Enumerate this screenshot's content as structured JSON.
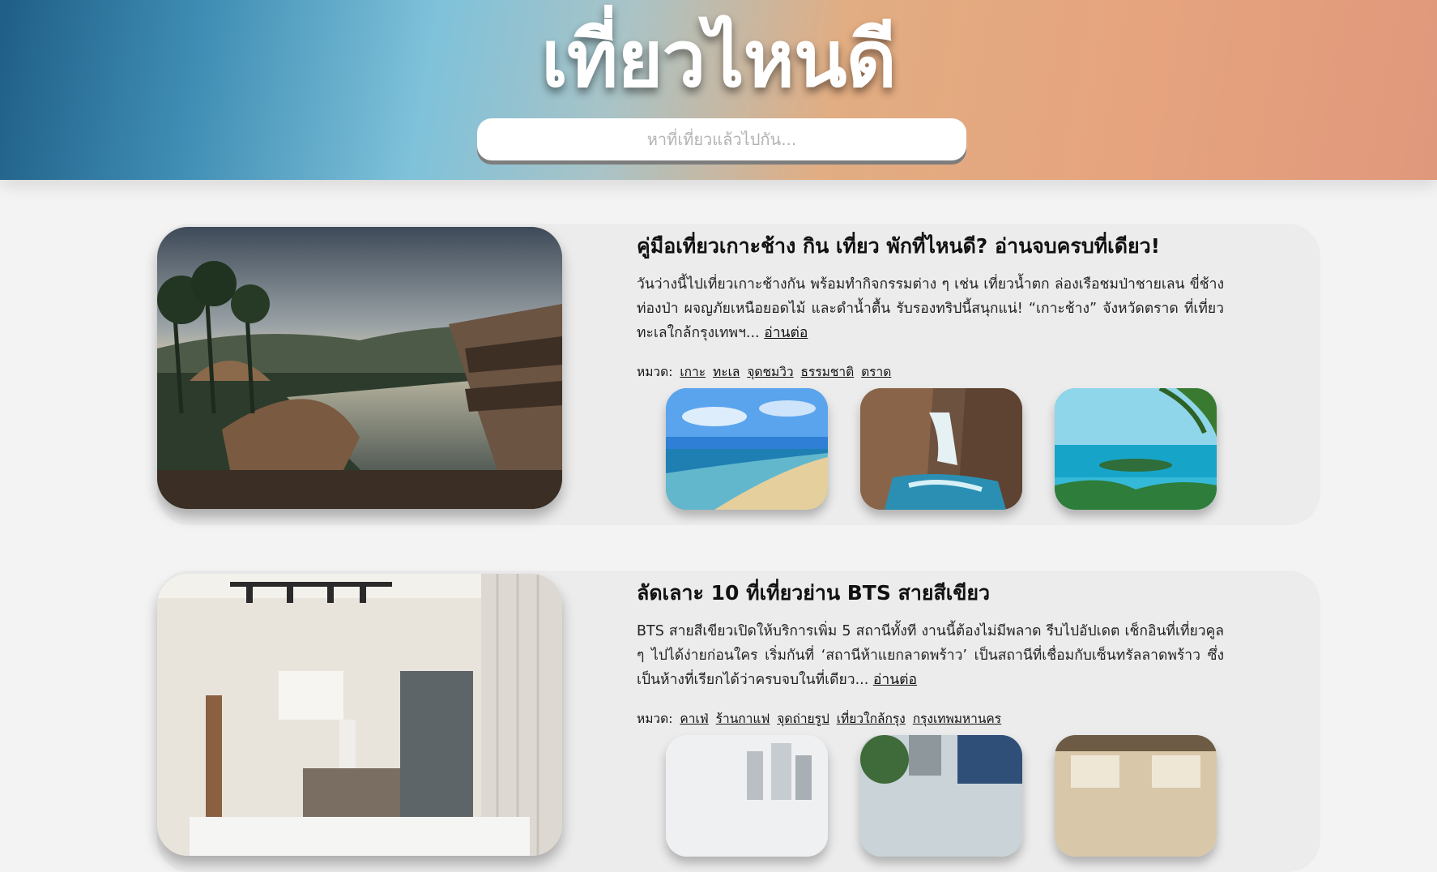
{
  "header": {
    "title": "เที่ยวไหนดี",
    "search_placeholder": "หาที่เที่ยวแล้วไปกัน..."
  },
  "articles": [
    {
      "title": "คู่มือเที่ยวเกาะช้าง กิน เที่ยว พักที่ไหนดี? อ่านจบครบที่เดียว!",
      "description": "วันว่างนี้ไปเที่ยวเกาะช้างกัน พร้อมทำกิจกรรมต่าง ๆ เช่น เที่ยวน้ำตก ล่องเรือชมป่าชายเลน ขี่ช้างท่องป่า ผจญภัยเหนือยอดไม้ และดำน้ำตื้น รับรองทริปนี้สนุกแน่! “เกาะช้าง” จังหวัดตราด ที่เที่ยวทะเลใกล้กรุงเทพฯ...",
      "read_more": "อ่านต่อ",
      "category_label": "หมวด:",
      "tags": [
        "เกาะ",
        "ทะเล",
        "จุดชมวิว",
        "ธรรมชาติ",
        "ตราด"
      ]
    },
    {
      "title": "ลัดเลาะ 10 ที่เที่ยวย่าน BTS สายสีเขียว",
      "description": "BTS สายสีเขียวเปิดให้บริการเพิ่ม 5 สถานีทั้งที งานนี้ต้องไม่มีพลาด รีบไปอัปเดต เช็กอินที่เที่ยวคูล ๆ ไปได้ง่ายก่อนใคร เริ่มกันที่ ‘สถานีห้าแยกลาดพร้าว’ เป็นสถานีที่เชื่อมกับเซ็นทรัลลาดพร้าว ซึ่งเป็นห้างที่เรียกได้ว่าครบจบในที่เดียว...",
      "read_more": "อ่านต่อ",
      "category_label": "หมวด:",
      "tags": [
        "คาเฟ่",
        "ร้านกาแฟ",
        "จุดถ่ายรูป",
        "เที่ยวใกล้กรุง",
        "กรุงเทพมหานคร"
      ]
    }
  ]
}
